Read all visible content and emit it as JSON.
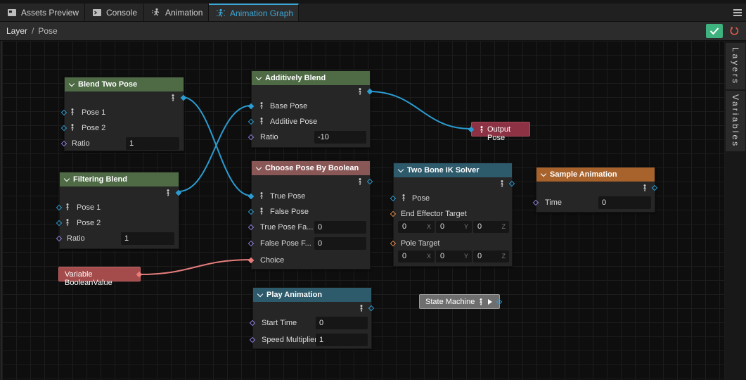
{
  "tabs": [
    {
      "label": "Assets Preview",
      "icon": "assets-preview-icon"
    },
    {
      "label": "Console",
      "icon": "console-icon"
    },
    {
      "label": "Animation",
      "icon": "animation-icon"
    },
    {
      "label": "Animation Graph",
      "icon": "animation-graph-icon",
      "active": true
    }
  ],
  "breadcrumb": {
    "root": "Layer",
    "sep": "/",
    "current": "Pose"
  },
  "sidebar": {
    "layers": "Layers",
    "variables": "Variables"
  },
  "colors": {
    "accent": "#3ea7d6",
    "pose_pin": "#2b9cd1",
    "number_pin": "#8b7fd8",
    "vector_pin": "#e08a4a",
    "bool_pin": "#e77d7d",
    "confirm": "#3fb37f",
    "reset": "#e05a4a"
  },
  "nodes": {
    "blend_two_pose": {
      "title": "Blend Two Pose",
      "pose1": "Pose 1",
      "pose2": "Pose 2",
      "ratio": "Ratio",
      "ratio_value": "1",
      "color": "#4e6b45"
    },
    "filtering_blend": {
      "title": "Filtering Blend",
      "pose1": "Pose 1",
      "pose2": "Pose 2",
      "ratio": "Ratio",
      "ratio_value": "1",
      "color": "#4e6b45"
    },
    "additively_blend": {
      "title": "Additively Blend",
      "base": "Base Pose",
      "additive": "Additive Pose",
      "ratio": "Ratio",
      "ratio_value": "-10",
      "color": "#4e6b45"
    },
    "choose_pose": {
      "title": "Choose Pose By Boolean",
      "true_pose": "True Pose",
      "false_pose": "False Pose",
      "true_fade": "True Pose Fa...",
      "true_fade_value": "0",
      "false_fade": "False Pose F...",
      "false_fade_value": "0",
      "choice": "Choice",
      "color": "#8a5757"
    },
    "two_bone_ik": {
      "title": "Two Bone IK Solver",
      "pose": "Pose",
      "end_effector": "End Effector Target",
      "ee": [
        "0",
        "0",
        "0"
      ],
      "pole": "Pole Target",
      "pt": [
        "0",
        "0",
        "0"
      ],
      "axes": [
        "X",
        "Y",
        "Z"
      ],
      "color": "#2e5b6c"
    },
    "sample_animation": {
      "title": "Sample Animation",
      "time": "Time",
      "time_value": "0",
      "color": "#a8622b"
    },
    "play_animation": {
      "title": "Play Animation",
      "start_time": "Start Time",
      "start_value": "0",
      "speed": "Speed Multiplier",
      "speed_value": "1",
      "color": "#2e5b6c"
    },
    "output_pose": {
      "title": "Output Pose"
    },
    "variable_bool": {
      "title": "Variable BooleanValue"
    },
    "state_machine": {
      "title": "State Machine"
    }
  }
}
